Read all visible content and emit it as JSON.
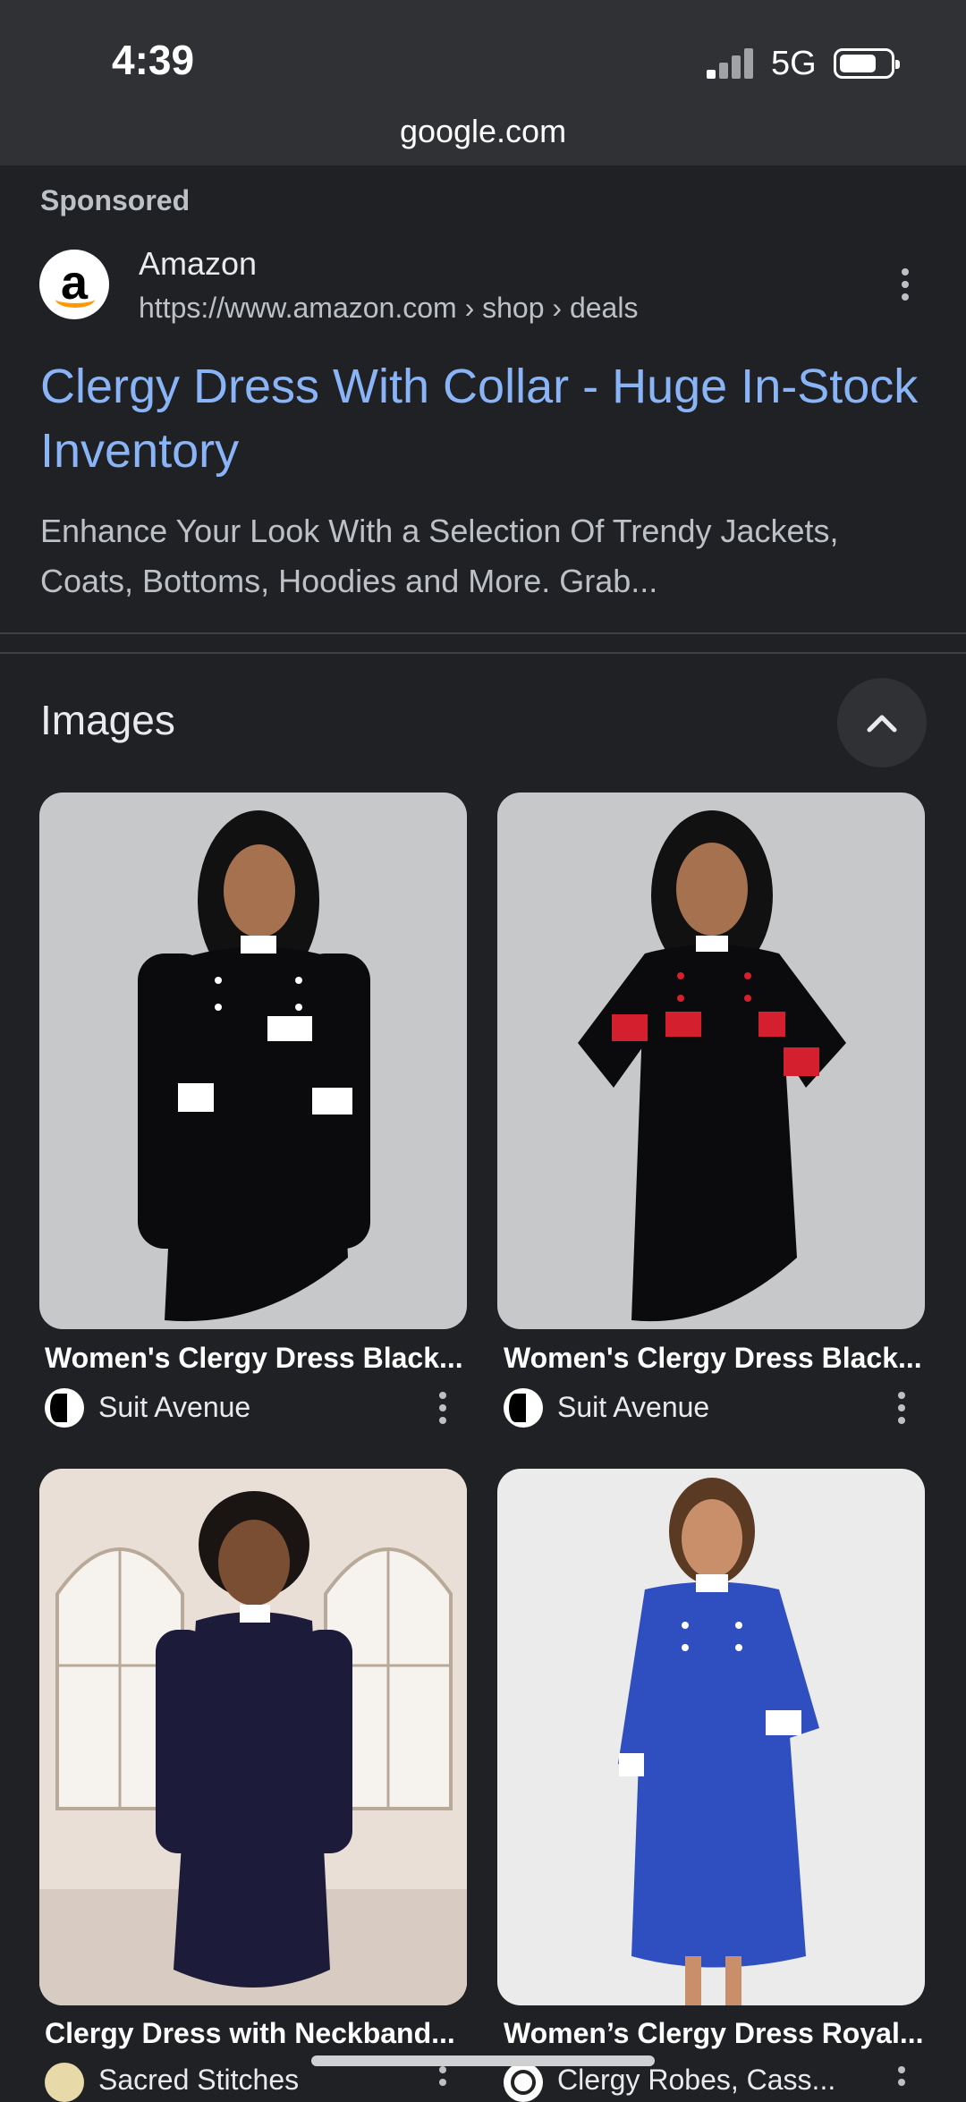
{
  "status_bar": {
    "time": "4:39",
    "network": "5G"
  },
  "address_bar": {
    "url": "google.com"
  },
  "ad": {
    "sponsored_label": "Sponsored",
    "advertiser": "Amazon",
    "display_url": "https://www.amazon.com › shop › deals",
    "title": "Clergy Dress With Collar - Huge In-Stock Inventory",
    "description": "Enhance Your Look With a Selection Of Trendy Jackets, Coats, Bottoms, Hoodies and More. Grab..."
  },
  "images_section": {
    "heading": "Images",
    "results": [
      {
        "caption": "Women's Clergy Dress Black...",
        "source": "Suit Avenue",
        "accent": "#ffffff",
        "dress": "#0b0b0d"
      },
      {
        "caption": "Women's Clergy Dress Black...",
        "source": "Suit Avenue",
        "accent": "#d4202e",
        "dress": "#0b0b0d"
      },
      {
        "caption": "Clergy Dress with Neckband...",
        "source": "Sacred Stitches",
        "accent": "#ffffff",
        "dress": "#1c1b3a"
      },
      {
        "caption": "Women’s Clergy Dress Royal...",
        "source": "Clergy Robes, Cass...",
        "accent": "#ffffff",
        "dress": "#2f4fc0"
      }
    ]
  },
  "colors": {
    "background": "#202124",
    "link": "#8ab4f8",
    "text_secondary": "#bdc1c6"
  }
}
